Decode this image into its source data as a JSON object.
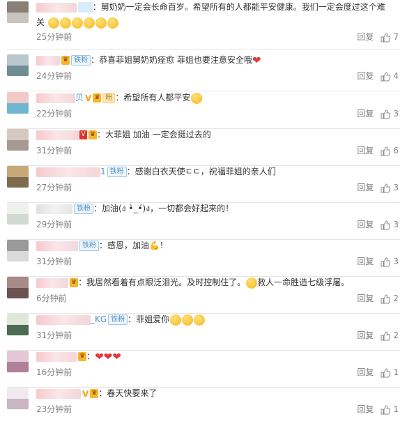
{
  "comments": [
    {
      "user_tail": "",
      "text": "舅奶奶一定会长命百岁。希望所有的人都能平安健康。我们一定会度过这个难",
      "text2": "关",
      "emoji_count": 6,
      "time": "25分钟前",
      "reply": "回复",
      "likes": "7"
    },
    {
      "user_tail": "",
      "badge": "铁粉",
      "text": "恭喜菲姐舅奶奶痊愈 菲姐也要注意安全哦",
      "time": "24分钟前",
      "reply": "回复",
      "likes": "4"
    },
    {
      "user_tail": "贝",
      "text": "希望所有人都平安",
      "time": "22分钟前",
      "reply": "回复",
      "likes": "3"
    },
    {
      "user_tail": "",
      "text": "大菲姐 加油 一定会挺过去的",
      "time": "31分钟前",
      "reply": "回复",
      "likes": "6"
    },
    {
      "user_tail": "1",
      "badge": "铁粉",
      "text": "感谢白衣天使ㄷㄷ，祝福菲姐的亲人们",
      "time": "27分钟前",
      "reply": "回复",
      "likes": "3"
    },
    {
      "user_tail": "",
      "badge": "铁粉",
      "text": "加油(ง •̀_•́)ง，一切都会好起来的！",
      "time": "29分钟前",
      "reply": "回复",
      "likes": "3"
    },
    {
      "user_tail": "",
      "badge": "铁粉",
      "text": "感恩，加油💪！",
      "time": "31分钟前",
      "reply": "回复",
      "likes": "3"
    },
    {
      "user_tail": "",
      "text": "我居然看着有点眼泛泪光。及时控制住了。",
      "text2": "救人一命胜造七级浮屠。",
      "time": "6分钟前",
      "reply": "回复",
      "likes": "2"
    },
    {
      "user_tail": "_KG",
      "badge": "铁粉",
      "text": "菲姐爱你",
      "emoji_count": 3,
      "time": "31分钟前",
      "reply": "回复",
      "likes": "2"
    },
    {
      "user_tail": "",
      "text": "",
      "time": "16分钟前",
      "reply": "回复",
      "likes": "1"
    },
    {
      "user_tail": "",
      "text": "春天快要来了",
      "time": "23分钟前",
      "reply": "回复",
      "likes": "1"
    }
  ],
  "colors": {
    "link": "#4f8fc4",
    "meta": "#808080",
    "heart": "#e4393c",
    "divider": "#e6e6e6"
  },
  "icons": {
    "like": "thumbs-up-icon",
    "heart": "heart-icon",
    "emoji": "emoji-icon",
    "vip": "vip-badge-icon"
  }
}
